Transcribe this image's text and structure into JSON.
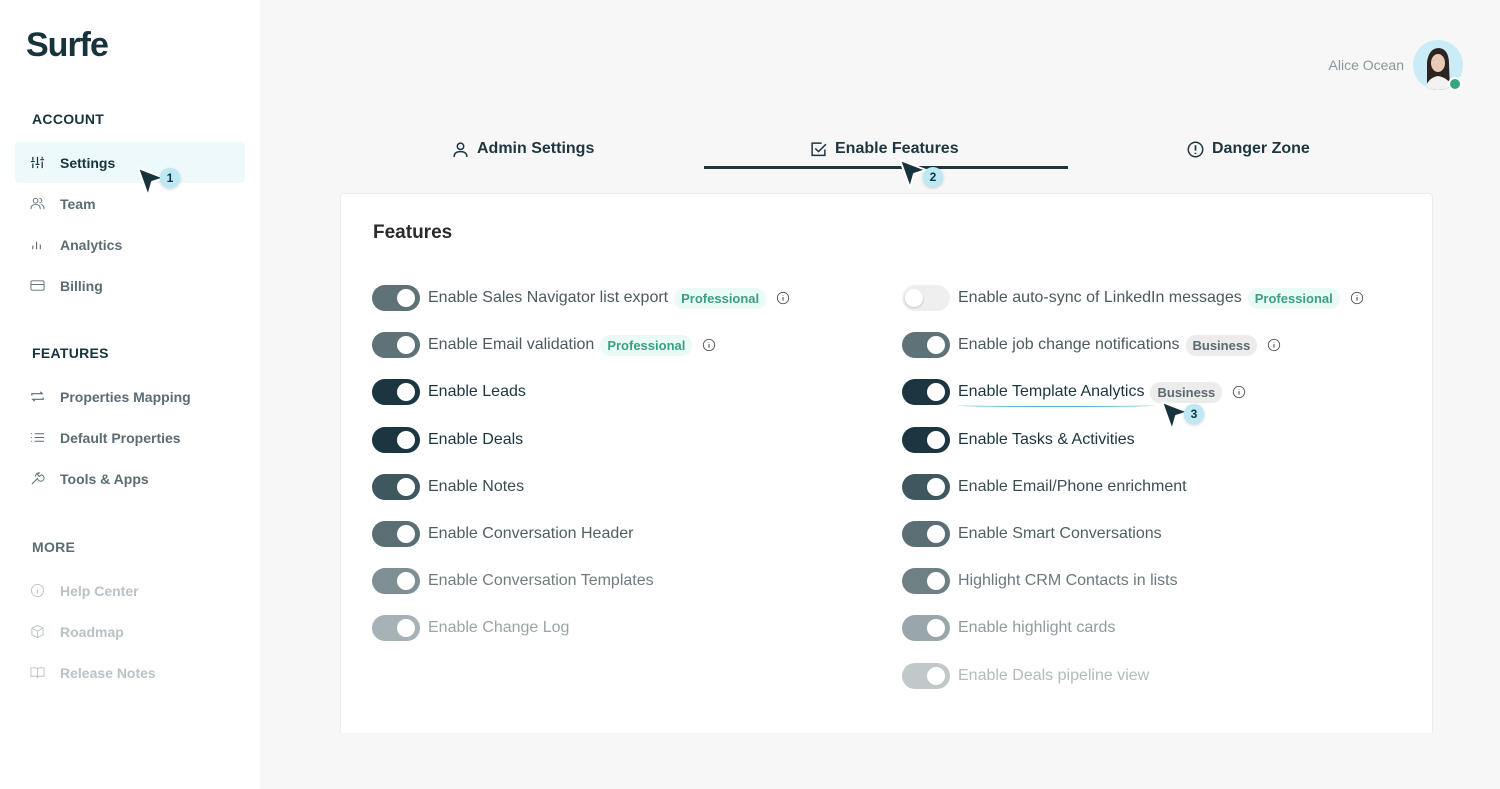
{
  "app": {
    "logo": "Surfe"
  },
  "sidebar": {
    "account_label": "ACCOUNT",
    "account_items": [
      {
        "label": "Settings",
        "icon": "sliders-icon",
        "active": true
      },
      {
        "label": "Team",
        "icon": "users-icon"
      },
      {
        "label": "Analytics",
        "icon": "bar-chart-icon"
      },
      {
        "label": "Billing",
        "icon": "credit-card-icon"
      }
    ],
    "features_label": "FEATURES",
    "features_items": [
      {
        "label": "Properties Mapping",
        "icon": "sync-icon"
      },
      {
        "label": "Default Properties",
        "icon": "list-icon"
      },
      {
        "label": "Tools & Apps",
        "icon": "wrench-icon"
      }
    ],
    "more_label": "MORE",
    "more_items": [
      {
        "label": "Help Center",
        "icon": "info-icon"
      },
      {
        "label": "Roadmap",
        "icon": "box-icon"
      },
      {
        "label": "Release Notes",
        "icon": "book-icon"
      }
    ]
  },
  "header": {
    "user_name": "Alice Ocean",
    "status": "online",
    "status_color": "#3aa584"
  },
  "tabs": [
    {
      "label": "Admin Settings",
      "icon": "user-icon"
    },
    {
      "label": "Enable Features",
      "icon": "checkbox-icon",
      "active": true
    },
    {
      "label": "Danger Zone",
      "icon": "alert-circle-icon"
    }
  ],
  "features": {
    "title": "Features",
    "left": [
      {
        "label": "Enable Sales Navigator list export",
        "badge": "Professional",
        "info": true,
        "enabled": true
      },
      {
        "label": "Enable Email validation",
        "badge": "Professional",
        "info": true,
        "enabled": true
      },
      {
        "label": "Enable Leads",
        "enabled": true
      },
      {
        "label": "Enable Deals",
        "enabled": true
      },
      {
        "label": "Enable Notes",
        "enabled": true
      },
      {
        "label": "Enable Conversation Header",
        "enabled": true
      },
      {
        "label": "Enable Conversation Templates",
        "enabled": true
      },
      {
        "label": "Enable Change Log",
        "enabled": true
      }
    ],
    "right": [
      {
        "label": "Enable auto-sync of LinkedIn messages",
        "badge": "Professional",
        "info": true,
        "enabled": false
      },
      {
        "label": "Enable job change notifications",
        "badge": "Business",
        "info": true,
        "enabled": true
      },
      {
        "label": "Enable Template Analytics",
        "badge": "Business",
        "info": true,
        "enabled": true
      },
      {
        "label": "Enable Tasks & Activities",
        "enabled": true
      },
      {
        "label": "Enable Email/Phone enrichment",
        "enabled": true
      },
      {
        "label": "Enable Smart Conversations",
        "enabled": true
      },
      {
        "label": "Highlight CRM Contacts in lists",
        "enabled": true
      },
      {
        "label": "Enable highlight cards",
        "enabled": true
      },
      {
        "label": "Enable Deals pipeline view",
        "enabled": true
      }
    ]
  },
  "annotations": [
    {
      "step": "1"
    },
    {
      "step": "2"
    },
    {
      "step": "3"
    }
  ],
  "colors": {
    "primary": "#1b3640",
    "professional": "#3c9f7f",
    "accent": "#bde9f5"
  }
}
